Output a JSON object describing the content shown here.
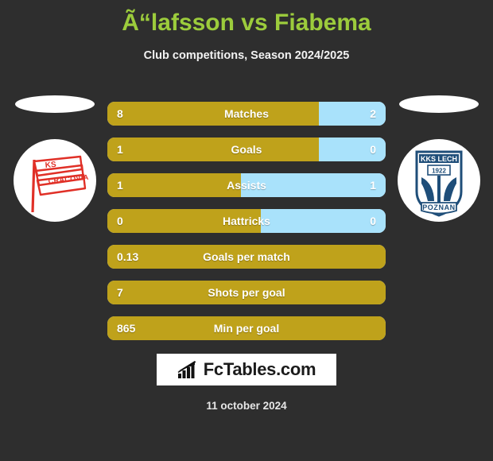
{
  "header": {
    "title": "Ã“lafsson vs Fiabema",
    "subtitle": "Club competitions, Season 2024/2025",
    "title_color": "#9ccc3c"
  },
  "teams": {
    "home": {
      "badge_name": "ks-cracovia-badge",
      "badge_text_top": "KS",
      "badge_text_main": "CRACOVIA",
      "badge_color": "#e03027"
    },
    "away": {
      "badge_name": "kks-lech-poznan-badge",
      "badge_text_top": "KKS LECH",
      "badge_text_year": "1922",
      "badge_text_bottom": "POZNAN",
      "badge_color": "#1f4e79"
    }
  },
  "colors": {
    "background": "#2e2e2e",
    "home_bar": "#bfa21b",
    "away_bar": "#a9e2fb",
    "accent": "#9ccc3c"
  },
  "stats": [
    {
      "label": "Matches",
      "home": "8",
      "away": "2",
      "home_pct": 76,
      "dual": true
    },
    {
      "label": "Goals",
      "home": "1",
      "away": "0",
      "home_pct": 76,
      "dual": true
    },
    {
      "label": "Assists",
      "home": "1",
      "away": "1",
      "home_pct": 48,
      "dual": true
    },
    {
      "label": "Hattricks",
      "home": "0",
      "away": "0",
      "home_pct": 55,
      "dual": true
    },
    {
      "label": "Goals per match",
      "home": "0.13",
      "away": "",
      "home_pct": 100,
      "dual": false
    },
    {
      "label": "Shots per goal",
      "home": "7",
      "away": "",
      "home_pct": 100,
      "dual": false
    },
    {
      "label": "Min per goal",
      "home": "865",
      "away": "",
      "home_pct": 100,
      "dual": false
    }
  ],
  "logo": {
    "text": "FcTables.com",
    "icon": "bar-chart-growth-icon"
  },
  "footer": {
    "date": "11 october 2024"
  }
}
